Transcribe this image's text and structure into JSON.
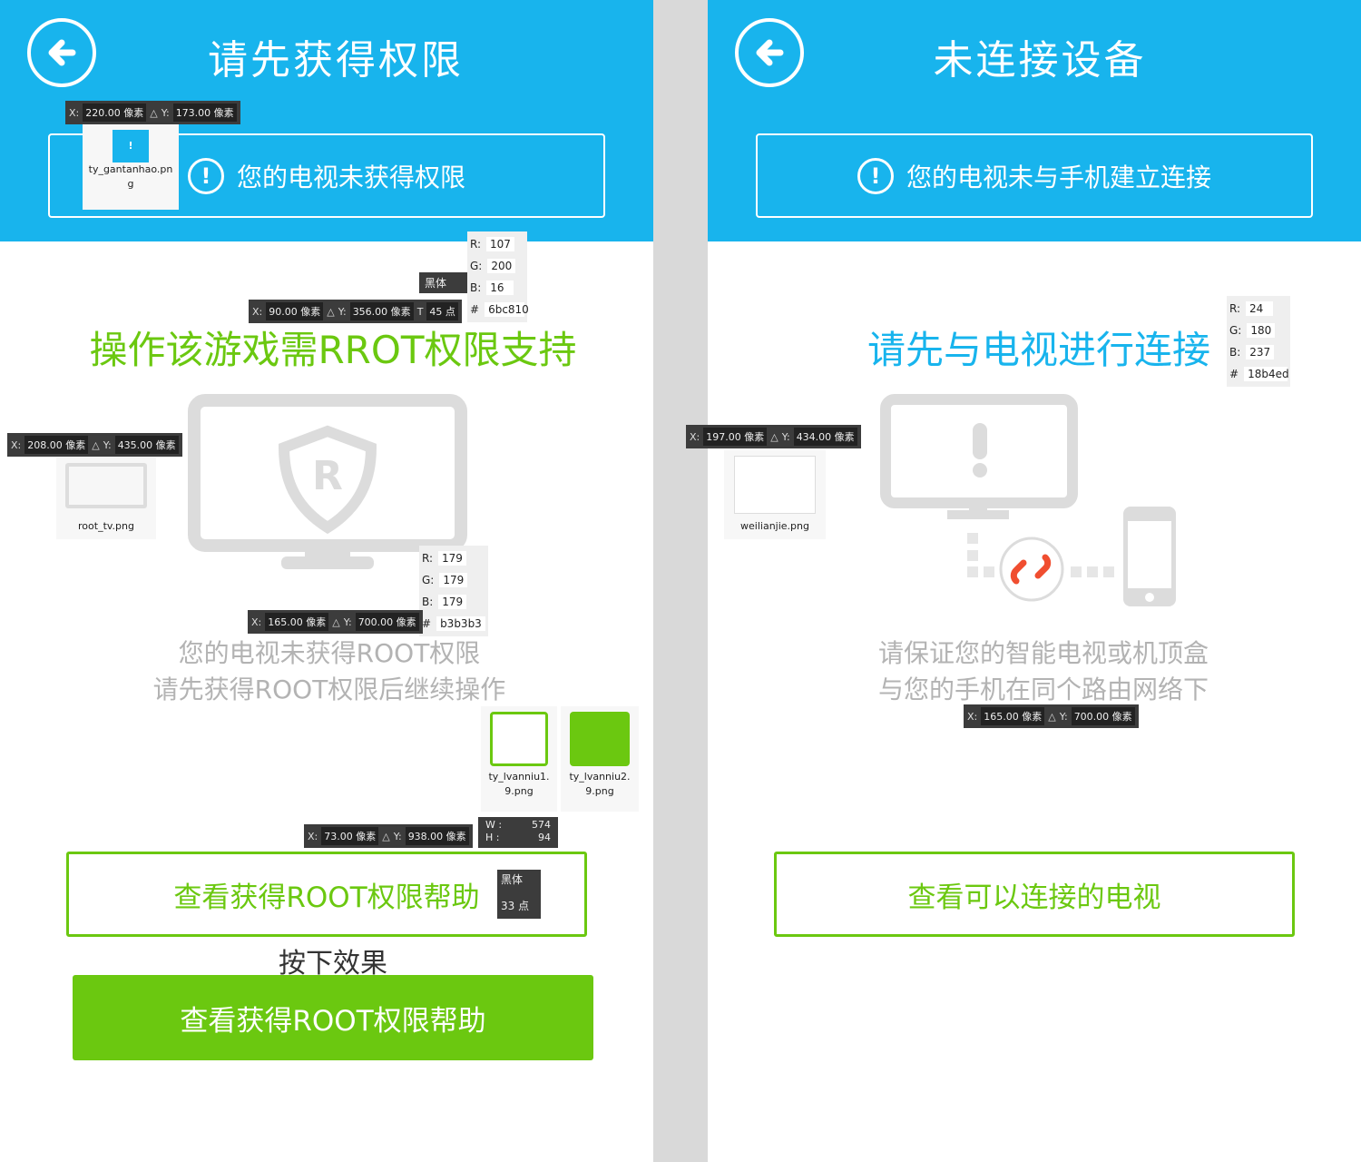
{
  "colors": {
    "blue": "#18b4ed",
    "green": "#6bc810",
    "gray": "#b3b3b3",
    "divider": "#d9d9d9"
  },
  "left": {
    "title": "请先获得权限",
    "notice": "您的电视未获得权限",
    "headline": "操作该游戏需RROT权限支持",
    "desc": [
      "您的电视未获得ROOT权限",
      "请先获得ROOT权限后继续操作"
    ],
    "button": "查看获得ROOT权限帮助",
    "pressed_caption": "按下效果",
    "pressed_button": "查看获得ROOT权限帮助"
  },
  "right": {
    "title": "未连接设备",
    "notice": "您的电视未与手机建立连接",
    "headline": "请先与电视进行连接",
    "desc": [
      "请保证您的智能电视或机顶盒",
      "与您的手机在同个路由网络下"
    ],
    "button": "查看可以连接的电视"
  },
  "annotations": {
    "coords": [
      {
        "x": "220.00 像素",
        "y": "173.00 像素"
      },
      {
        "x": "90.00 像素",
        "y": "356.00 像素"
      },
      {
        "x": "208.00 像素",
        "y": "435.00 像素"
      },
      {
        "x": "165.00 像素",
        "y": "700.00 像素"
      },
      {
        "x": "73.00 像素",
        "y": "938.00 像素"
      },
      {
        "x": "197.00 像素",
        "y": "434.00 像素"
      },
      {
        "x": "165.00 像素",
        "y": "700.00 像素"
      }
    ],
    "labels": {
      "x": "X:",
      "y": "Y:",
      "delta": "△",
      "r": "R:",
      "g": "G:",
      "b": "B:",
      "hash": "#",
      "w": "W :",
      "h": "H :"
    },
    "colors": [
      {
        "r": "107",
        "g": "200",
        "b": "16",
        "hex": "6bc810"
      },
      {
        "r": "179",
        "g": "179",
        "b": "179",
        "hex": "b3b3b3"
      },
      {
        "r": "24",
        "g": "180",
        "b": "237",
        "hex": "18b4ed"
      }
    ],
    "fonts": [
      {
        "name": "黑体",
        "size": "45 点"
      },
      {
        "name": "黑体",
        "size": "33 点"
      }
    ],
    "size": {
      "w": "574",
      "h": "94"
    },
    "files": [
      "ty_gantanhao.png",
      "root_tv.png",
      "ty_lvanniu1.9.png",
      "ty_lvanniu2.9.png",
      "weilianjie.png"
    ]
  }
}
